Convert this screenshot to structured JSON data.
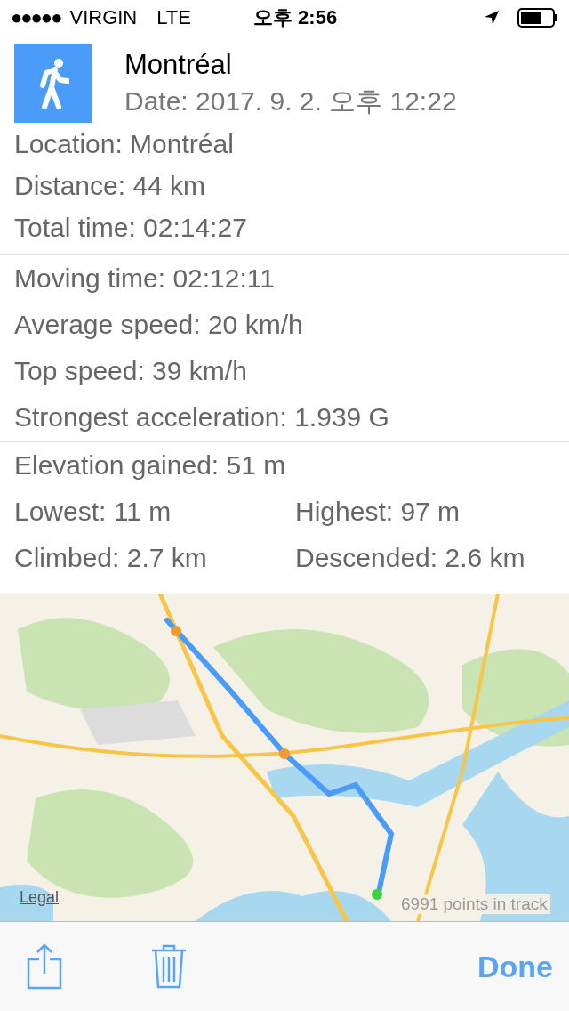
{
  "status_bar": {
    "signal_dots": "●●●●●",
    "carrier": "VIRGIN",
    "network": "LTE",
    "time": "오후 2:56"
  },
  "header": {
    "title": "Montréal",
    "date": "Date: 2017. 9. 2. 오후 12:22"
  },
  "sections": [
    {
      "rows": [
        [
          "Location: Montréal"
        ],
        [
          "Distance: 44 km"
        ],
        [
          "Total time: 02:14:27"
        ]
      ]
    },
    {
      "rows": [
        [
          "Moving time: 02:12:11"
        ],
        [
          "Average speed: 20 km/h"
        ],
        [
          "Top speed: 39 km/h"
        ],
        [
          "Strongest acceleration: 1.939 G"
        ]
      ]
    },
    {
      "rows": [
        [
          "Elevation gained: 51 m"
        ],
        [
          "Lowest: 11 m",
          "Highest: 97 m"
        ],
        [
          "Climbed: 2.7 km",
          "Descended: 2.6 km"
        ]
      ]
    }
  ],
  "map": {
    "kind": "picture",
    "legal": "Legal",
    "points_label": "6991 points in track"
  },
  "toolbar": {
    "done": "Done"
  }
}
